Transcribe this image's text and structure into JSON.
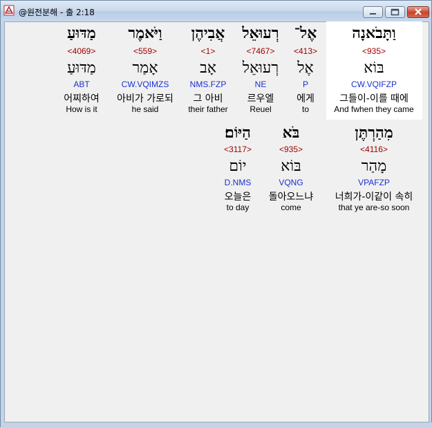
{
  "window": {
    "title": "@원전분해 - 출 2:18"
  },
  "rows": [
    {
      "words": [
        {
          "hebrew": "וַתָּבֹאנָה",
          "strong": "<935>",
          "root": "בּוֹא",
          "parse": "CW.VQIFZP",
          "korean": "그들이-이를 때에",
          "english": "And fwhen they came",
          "highlighted": true
        },
        {
          "hebrew": "אֶל־",
          "strong": "<413>",
          "root": "אֶל",
          "parse": "P",
          "korean": "에게",
          "english": "to",
          "highlighted": false
        },
        {
          "hebrew": "רְעוּאֵל",
          "strong": "<7467>",
          "root": "רְעוּאֵל",
          "parse": "NE",
          "korean": "르우엘",
          "english": "Reuel",
          "highlighted": false
        },
        {
          "hebrew": "אֲבִיהֶן",
          "strong": "<1>",
          "root": "אָב",
          "parse": "NMS.FZP",
          "korean": "그 아비",
          "english": "their father",
          "highlighted": false
        },
        {
          "hebrew": "וַיֹּאמֶר",
          "strong": "<559>",
          "root": "אָמַר",
          "parse": "CW.VQIMZS",
          "korean": "아비가 가로되",
          "english": "he said",
          "highlighted": false
        },
        {
          "hebrew": "מַדּוּעַ",
          "strong": "<4069>",
          "root": "מַדּוּעַ",
          "parse": "ABT",
          "korean": "어찌하여",
          "english": "How is it",
          "highlighted": false
        }
      ]
    },
    {
      "words": [
        {
          "hebrew": "מִהַרְתֶּן",
          "strong": "<4116>",
          "root": "מָהַר",
          "parse": "VPAFZP",
          "korean": "너희가-이같이 속히",
          "english": "that ye are-so soon"
        },
        {
          "hebrew": "בֹּא",
          "strong": "<935>",
          "root": "בּוֹא",
          "parse": "VQNG",
          "korean": "돌아오느냐",
          "english": "come"
        },
        {
          "hebrew": "הַיּוֹם׃",
          "strong": "<3117>",
          "root": "יוֹם",
          "parse": "D.NMS",
          "korean": "오늘은",
          "english": "to day"
        }
      ]
    }
  ]
}
